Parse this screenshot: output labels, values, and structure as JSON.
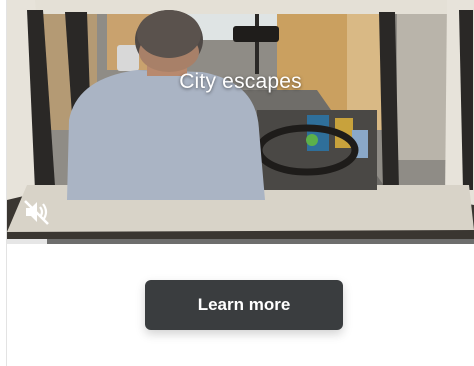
{
  "video": {
    "title": "City escapes",
    "muted": true,
    "progress": 0.085
  },
  "cta": {
    "label": "Learn more"
  },
  "colors": {
    "button_bg": "#3a3d3f",
    "button_text": "#ffffff",
    "progress_track": "#787878",
    "progress_fill": "#e6e6e6"
  },
  "icons": {
    "mute": "speaker-muted-icon"
  }
}
